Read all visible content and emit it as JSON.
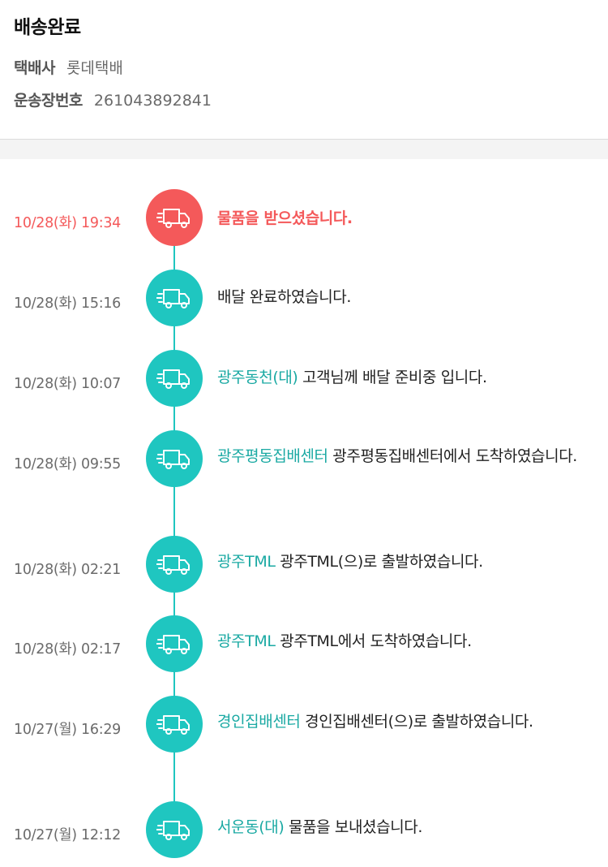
{
  "header": {
    "status_title": "배송완료",
    "courier_label": "택배사",
    "courier_value": "롯데택배",
    "tracking_label": "운송장번호",
    "tracking_value": "261043892841"
  },
  "colors": {
    "accent_teal": "#1fc6c0",
    "location_teal": "#1aa9a3",
    "current_red": "#f4595a"
  },
  "icons": {
    "event_icon": "delivery-truck-icon"
  },
  "events": [
    {
      "time": "10/28(화) 19:34",
      "location": "",
      "message": "물품을 받으셨습니다.",
      "current": true
    },
    {
      "time": "10/28(화) 15:16",
      "location": "",
      "message": "배달 완료하였습니다."
    },
    {
      "time": "10/28(화) 10:07",
      "location": "광주동천(대)",
      "message": "고객님께 배달 준비중 입니다."
    },
    {
      "time": "10/28(화) 09:55",
      "location": "광주평동집배센터",
      "message": "광주평동집배센터에서 도착하였습니다."
    },
    {
      "time": "10/28(화) 02:21",
      "location": "광주TML",
      "message": "광주TML(으)로 출발하였습니다."
    },
    {
      "time": "10/28(화) 02:17",
      "location": "광주TML",
      "message": "광주TML에서 도착하였습니다."
    },
    {
      "time": "10/27(월) 16:29",
      "location": "경인집배센터",
      "message": "경인집배센터(으)로 출발하였습니다."
    },
    {
      "time": "10/27(월) 12:12",
      "location": "서운동(대)",
      "message": "물품을 보내셨습니다."
    }
  ]
}
